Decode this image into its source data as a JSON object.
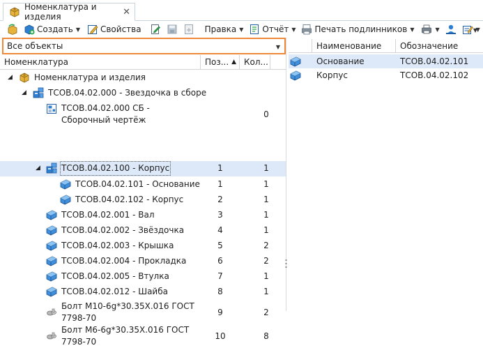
{
  "tab": {
    "title": "Номенклатура и изделия",
    "close_glyph": "✕",
    "icon": "box-icon"
  },
  "toolbar": {
    "create_label": "Создать",
    "properties_label": "Свойства",
    "edit_label": "Правка",
    "report_label": "Отчёт",
    "print_label": "Печать подлинников"
  },
  "filter": {
    "value": "Все объекты"
  },
  "tree": {
    "headers": {
      "name": "Номенклатура",
      "pos": "Поз...",
      "qty": "Кол..."
    },
    "rows": [
      {
        "text": "Номенклатура и изделия",
        "pos": "",
        "qty": "",
        "icon": "box-icon"
      },
      {
        "text": "ТСОВ.04.02.000 - Звездочка в сборе",
        "pos": "",
        "qty": "",
        "icon": "assembly-icon"
      },
      {
        "text": "ТСОВ.04.02.000 СБ - Сборочный чертёж",
        "pos": "",
        "qty": "0",
        "icon": "drawing-icon"
      },
      {
        "text": "ТСОВ.04.02.100 - Корпус",
        "pos": "1",
        "qty": "1",
        "icon": "assembly-icon"
      },
      {
        "text": "ТСОВ.04.02.101 - Основание",
        "pos": "1",
        "qty": "1",
        "icon": "part-icon"
      },
      {
        "text": "ТСОВ.04.02.102 - Корпус",
        "pos": "2",
        "qty": "1",
        "icon": "part-icon"
      },
      {
        "text": "ТСОВ.04.02.001 - Вал",
        "pos": "3",
        "qty": "1",
        "icon": "part-icon"
      },
      {
        "text": "ТСОВ.04.02.002 - Звёздочка",
        "pos": "4",
        "qty": "1",
        "icon": "part-icon"
      },
      {
        "text": "ТСОВ.04.02.003 - Крышка",
        "pos": "5",
        "qty": "2",
        "icon": "part-icon"
      },
      {
        "text": "ТСОВ.04.02.004 - Прокладка",
        "pos": "6",
        "qty": "2",
        "icon": "part-icon"
      },
      {
        "text": "ТСОВ.04.02.005 - Втулка",
        "pos": "7",
        "qty": "1",
        "icon": "part-icon"
      },
      {
        "text": "ТСОВ.04.02.012 - Шайба",
        "pos": "8",
        "qty": "1",
        "icon": "part-icon"
      },
      {
        "text": "Болт М10-6g*30.35Х.016 ГОСТ 7798-70",
        "pos": "9",
        "qty": "2",
        "icon": "standard-part-icon"
      },
      {
        "text": "Болт М6-6g*30.35Х.016 ГОСТ 7798-70",
        "pos": "10",
        "qty": "8",
        "icon": "standard-part-icon"
      }
    ]
  },
  "detail": {
    "headers": {
      "name": "Наименование",
      "designation": "Обозначение"
    },
    "rows": [
      {
        "name": "Основание",
        "designation": "ТСОВ.04.02.101",
        "icon": "part-icon"
      },
      {
        "name": "Корпус",
        "designation": "ТСОВ.04.02.102",
        "icon": "part-icon"
      }
    ]
  },
  "colors": {
    "accent_border": "#f0883a",
    "selection": "#dde8f8",
    "part_blue": "#2f7fd0",
    "box_gold": "#d9a21b"
  }
}
